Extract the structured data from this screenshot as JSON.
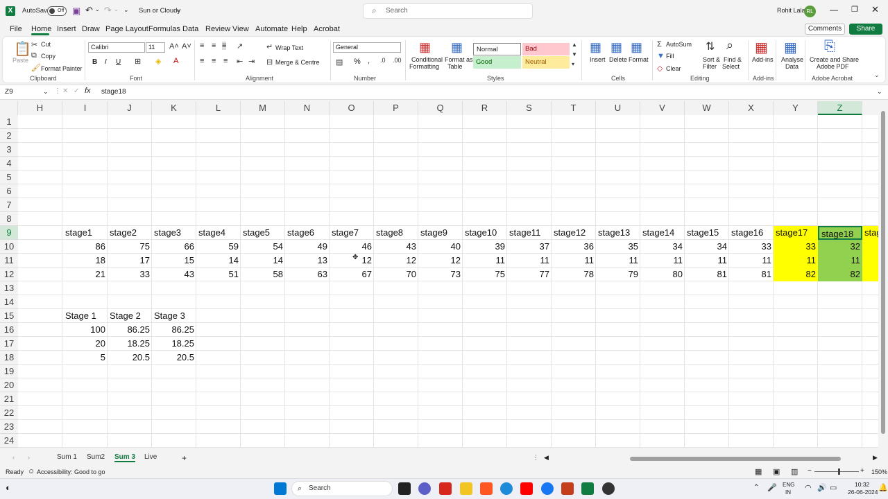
{
  "titlebar": {
    "autosave_label": "AutoSave",
    "autosave_state": "Off",
    "file_name": "Sun or Cloudy",
    "search_placeholder": "Search",
    "user_name": "Rohit Lala",
    "user_initials": "RL"
  },
  "menu": {
    "items": [
      "File",
      "Home",
      "Insert",
      "Draw",
      "Page Layout",
      "Formulas",
      "Data",
      "Review",
      "View",
      "Automate",
      "Help",
      "Acrobat"
    ],
    "active": "Home",
    "comments_label": "Comments",
    "share_label": "Share"
  },
  "ribbon": {
    "clipboard": {
      "paste": "Paste",
      "cut": "Cut",
      "copy": "Copy",
      "format_painter": "Format Painter",
      "label": "Clipboard"
    },
    "font": {
      "family": "Calibri",
      "size": "11",
      "label": "Font",
      "bold": "B",
      "italic": "I",
      "underline": "U"
    },
    "alignment": {
      "wrap": "Wrap Text",
      "merge": "Merge & Centre",
      "label": "Alignment"
    },
    "number": {
      "format": "General",
      "percent": "%",
      "label": "Number"
    },
    "styles": {
      "conditional": [
        "Conditional",
        "Formatting"
      ],
      "format_table": [
        "Format as",
        "Table"
      ],
      "normal": "Normal",
      "bad": "Bad",
      "good": "Good",
      "neutral": "Neutral",
      "label": "Styles"
    },
    "cells": {
      "insert": "Insert",
      "delete": "Delete",
      "format": "Format",
      "label": "Cells"
    },
    "editing": {
      "autosum": "AutoSum",
      "fill": "Fill",
      "clear": "Clear",
      "sort": [
        "Sort &",
        "Filter"
      ],
      "find": [
        "Find &",
        "Select"
      ],
      "label": "Editing"
    },
    "addins": {
      "addins": "Add-ins",
      "label": "Add-ins"
    },
    "analyse": [
      "Analyse",
      "Data"
    ],
    "adobe": {
      "create": [
        "Create and Share",
        "Adobe PDF"
      ],
      "label": "Adobe Acrobat"
    }
  },
  "formula_bar": {
    "name_box": "Z9",
    "content": "stage18"
  },
  "columns": [
    "H",
    "I",
    "J",
    "K",
    "L",
    "M",
    "N",
    "O",
    "P",
    "Q",
    "R",
    "S",
    "T",
    "U",
    "V",
    "W",
    "X",
    "Y",
    "Z"
  ],
  "selected_column": "Z",
  "rows": [
    "1",
    "2",
    "3",
    "4",
    "5",
    "6",
    "7",
    "8",
    "9",
    "10",
    "11",
    "12",
    "13",
    "14",
    "15",
    "16",
    "17",
    "18",
    "19",
    "20",
    "21",
    "22",
    "23",
    "24"
  ],
  "selected_row": "9",
  "table1": {
    "headers": [
      "stage1",
      "stage2",
      "stage3",
      "stage4",
      "stage5",
      "stage6",
      "stage7",
      "stage8",
      "stage9",
      "stage10",
      "stage11",
      "stage12",
      "stage13",
      "stage14",
      "stage15",
      "stage16",
      "stage17",
      "stage18",
      "stag"
    ],
    "row10": [
      "86",
      "75",
      "66",
      "59",
      "54",
      "49",
      "46",
      "43",
      "40",
      "39",
      "37",
      "36",
      "35",
      "34",
      "34",
      "33",
      "33",
      "32"
    ],
    "row11": [
      "18",
      "17",
      "15",
      "14",
      "14",
      "13",
      "12",
      "12",
      "12",
      "11",
      "11",
      "11",
      "11",
      "11",
      "11",
      "11",
      "11",
      "11"
    ],
    "row12": [
      "21",
      "33",
      "43",
      "51",
      "58",
      "63",
      "67",
      "70",
      "73",
      "75",
      "77",
      "78",
      "79",
      "80",
      "81",
      "81",
      "82",
      "82"
    ]
  },
  "table2": {
    "headers": [
      "Stage 1",
      "Stage 2",
      "Stage 3"
    ],
    "rows": [
      [
        "100",
        "86.25",
        "86.25"
      ],
      [
        "20",
        "18.25",
        "18.25"
      ],
      [
        "5",
        "20.5",
        "20.5"
      ]
    ]
  },
  "sheets": {
    "tabs": [
      "Sum 1",
      "Sum2",
      "Sum 3",
      "Live"
    ],
    "active": "Sum 3"
  },
  "status": {
    "ready": "Ready",
    "accessibility": "Accessibility: Good to go",
    "zoom": "150%"
  },
  "taskbar": {
    "search": "Search",
    "lang1": "ENG",
    "lang2": "IN",
    "time": "10:32",
    "date": "26-06-2024"
  },
  "colors": {
    "accent": "#107c41",
    "highlight_yellow": "#ffff00",
    "highlight_green": "#92d050"
  }
}
